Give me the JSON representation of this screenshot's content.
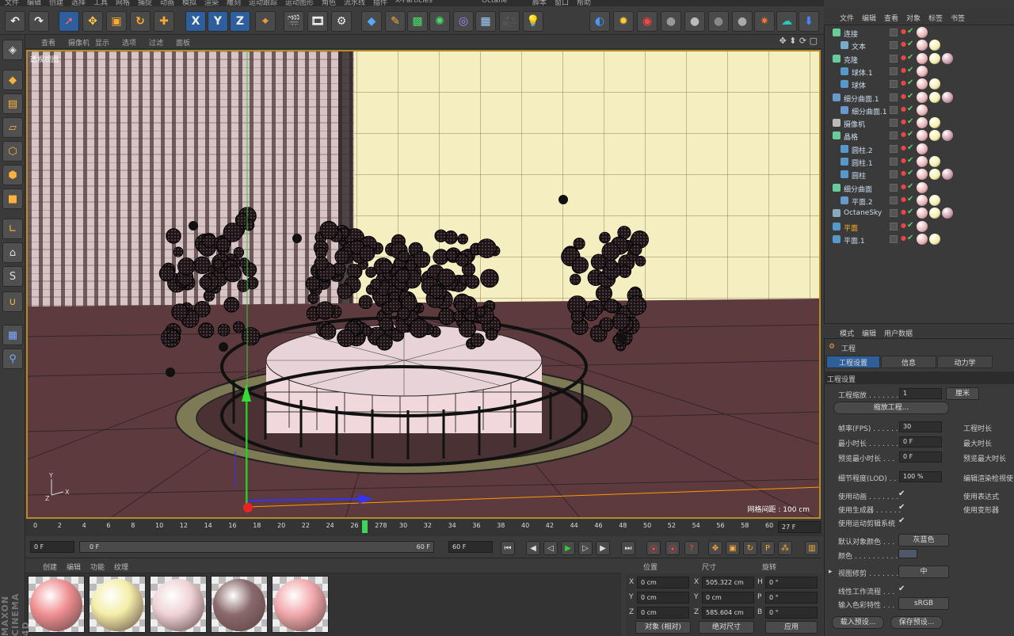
{
  "top_menu": [
    "文件",
    "编辑",
    "创建",
    "选择",
    "工具",
    "网格",
    "捕捉",
    "动画",
    "模拟",
    "渲染",
    "雕刻",
    "运动跟踪",
    "运动图形",
    "角色",
    "流水线",
    "插件",
    "X-Particles",
    "Octane",
    "脚本",
    "窗口",
    "帮助"
  ],
  "toolbar": {
    "x": "X",
    "y": "Y",
    "z": "Z"
  },
  "viewport": {
    "menu": [
      "查看",
      "摄像机",
      "显示",
      "选项",
      "过滤",
      "面板"
    ],
    "label": "透视视图",
    "grid_distance": "网格间距 : 100 cm"
  },
  "timeline": {
    "ticks": [
      "0",
      "2",
      "4",
      "6",
      "8",
      "10",
      "12",
      "14",
      "16",
      "18",
      "20",
      "22",
      "24",
      "26",
      "278",
      "30",
      "32",
      "34",
      "36",
      "38",
      "40",
      "42",
      "44",
      "46",
      "48",
      "50",
      "52",
      "54",
      "56",
      "58",
      "60"
    ],
    "current_frame": "27 F",
    "start": "0 F",
    "slider_start": "0 F",
    "slider_end": "60 F",
    "end": "60 F"
  },
  "materials": {
    "menu": [
      "创建",
      "编辑",
      "功能",
      "纹理"
    ],
    "swatches": [
      {
        "color": "#f08f92"
      },
      {
        "color": "#f3eea7"
      },
      {
        "color": "#efd3d6"
      },
      {
        "color": "#8a6a6c"
      },
      {
        "color": "#f2a9ad"
      }
    ]
  },
  "coords": {
    "headers": [
      "位置",
      "尺寸",
      "旋转"
    ],
    "rows": [
      {
        "a": "X",
        "pos": "0 cm",
        "b": "X",
        "size": "505.322 cm",
        "c": "H",
        "rot": "0 °"
      },
      {
        "a": "Y",
        "pos": "0 cm",
        "b": "Y",
        "size": "0 cm",
        "c": "P",
        "rot": "0 °"
      },
      {
        "a": "Z",
        "pos": "0 cm",
        "b": "Z",
        "size": "585.604 cm",
        "c": "B",
        "rot": "0 °"
      }
    ],
    "mode1": "对象 (相对)",
    "mode2": "绝对尺寸",
    "apply": "应用"
  },
  "objects": {
    "menu": [
      "文件",
      "编辑",
      "查看",
      "对象",
      "标签",
      "书签"
    ],
    "items": [
      {
        "name": "连接",
        "indent": 0,
        "icon": "#6c9"
      },
      {
        "name": "文本",
        "indent": 1,
        "icon": "#7ac"
      },
      {
        "name": "克隆",
        "indent": 0,
        "icon": "#6c9"
      },
      {
        "name": "球体.1",
        "indent": 1,
        "icon": "#59c"
      },
      {
        "name": "球体",
        "indent": 1,
        "icon": "#59c"
      },
      {
        "name": "细分曲面.1",
        "indent": 0,
        "icon": "#69c"
      },
      {
        "name": "细分曲面.1",
        "indent": 1,
        "icon": "#69c"
      },
      {
        "name": "摄像机",
        "indent": 0,
        "icon": "#bbb"
      },
      {
        "name": "晶格",
        "indent": 0,
        "icon": "#6c9"
      },
      {
        "name": "圆柱.2",
        "indent": 1,
        "icon": "#59c"
      },
      {
        "name": "圆柱.1",
        "indent": 1,
        "icon": "#59c"
      },
      {
        "name": "圆柱",
        "indent": 1,
        "icon": "#59c"
      },
      {
        "name": "细分曲面",
        "indent": 0,
        "icon": "#6c9"
      },
      {
        "name": "平面.2",
        "indent": 1,
        "icon": "#69c"
      },
      {
        "name": "OctaneSky",
        "indent": 0,
        "icon": "#8ab"
      },
      {
        "name": "平面",
        "indent": 0,
        "icon": "#59c",
        "highlight": true
      },
      {
        "name": "平面.1",
        "indent": 0,
        "icon": "#59c"
      }
    ]
  },
  "attributes": {
    "menu": [
      "模式",
      "编辑",
      "用户数据"
    ],
    "title": "工程",
    "tabs": [
      "工程设置",
      "信息",
      "动力学"
    ],
    "section": "工程设置",
    "scale_label": "工程缩放 . . . . . . .",
    "scale_value": "1",
    "scale_unit": "厘米",
    "scale_btn": "缩放工程...",
    "fps_label": "帧率(FPS) . . . . . .",
    "fps_value": "30",
    "duration_label": "工程时长",
    "min_label": "最小时长 . . . . . . .",
    "min_value": "0 F",
    "max_label": "最大时长",
    "pmin_label": "预览最小时长 . . .",
    "pmin_value": "0 F",
    "pmax_label": "预览最大时长",
    "lod_label": "细节程度(LOD) . . .",
    "lod_value": "100 %",
    "lod_right": "编辑渲染检视使",
    "anim_label": "使用动画 . . . . . . .",
    "expr_label": "使用表达式",
    "gen_label": "使用生成器 . . . . . .",
    "deform_label": "使用变形器",
    "mg_label": "使用运动剪辑系统",
    "color_label": "默认对象颜色 . . .",
    "color_value": "灰蓝色",
    "color2_label": "颜色 . . . . . . . . . . .",
    "clip_label": "视图修剪 . . . . . . .",
    "clip_value": "中",
    "linear_label": "线性工作流程 . . .",
    "input_label": "输入色彩特性 . . .",
    "input_value": "sRGB",
    "load_btn": "载入预设...",
    "save_btn": "保存预设..."
  },
  "brand": "MAXON CINEMA 4D"
}
